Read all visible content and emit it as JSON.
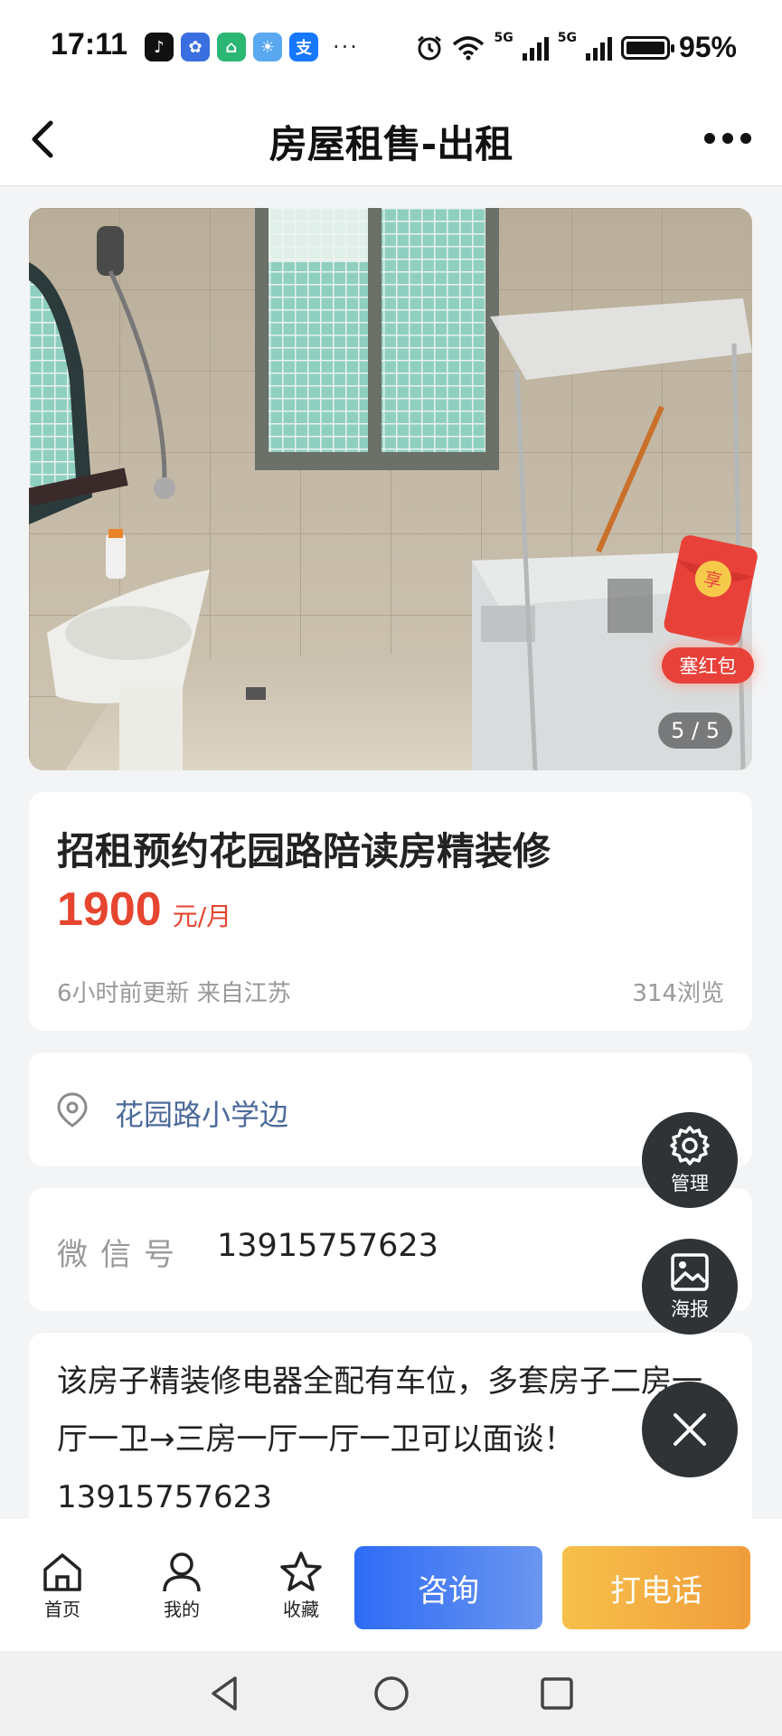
{
  "status_bar": {
    "time": "17:11",
    "apps": [
      {
        "name": "tiktok-icon",
        "glyph": "♪",
        "color": "#111111"
      },
      {
        "name": "baidu-icon",
        "glyph": "✿",
        "color": "#3a6fe0"
      },
      {
        "name": "house-app-icon",
        "glyph": "⌂",
        "color": "#2bb673"
      },
      {
        "name": "weather-icon",
        "glyph": "☀",
        "color": "#5aa9f0"
      },
      {
        "name": "alipay-icon",
        "glyph": "支",
        "color": "#1677ff"
      }
    ],
    "more": "···",
    "network_1": "5G",
    "network_2": "5G",
    "battery": "95%"
  },
  "header": {
    "title": "房屋租售-出租"
  },
  "photo": {
    "counter": "5 / 5"
  },
  "red_packet": {
    "badge": "享",
    "label": "塞红包"
  },
  "listing": {
    "title": "招租预约花园路陪读房精装修",
    "price": "1900",
    "price_unit": "元/月",
    "updated": "6小时前更新 来自江苏",
    "views": "314浏览"
  },
  "location": {
    "text": "花园路小学边"
  },
  "wechat": {
    "label": "微信号",
    "value": "13915757623"
  },
  "description": {
    "text": "该房子精装修电器全配有车位，多套房子二房一厅一卫→三房一厅一厅一卫可以面谈！13915757623"
  },
  "fabs": {
    "manage": "管理",
    "poster": "海报"
  },
  "bottom_bar": {
    "home": "首页",
    "mine": "我的",
    "favorite": "收藏",
    "consult": "咨询",
    "call": "打电话"
  },
  "colors": {
    "price": "#e6452f",
    "location": "#4c6a9a",
    "consult_button": "#2e6bf6",
    "call_button": "#f09d3c",
    "red_packet": "#e8413a"
  }
}
